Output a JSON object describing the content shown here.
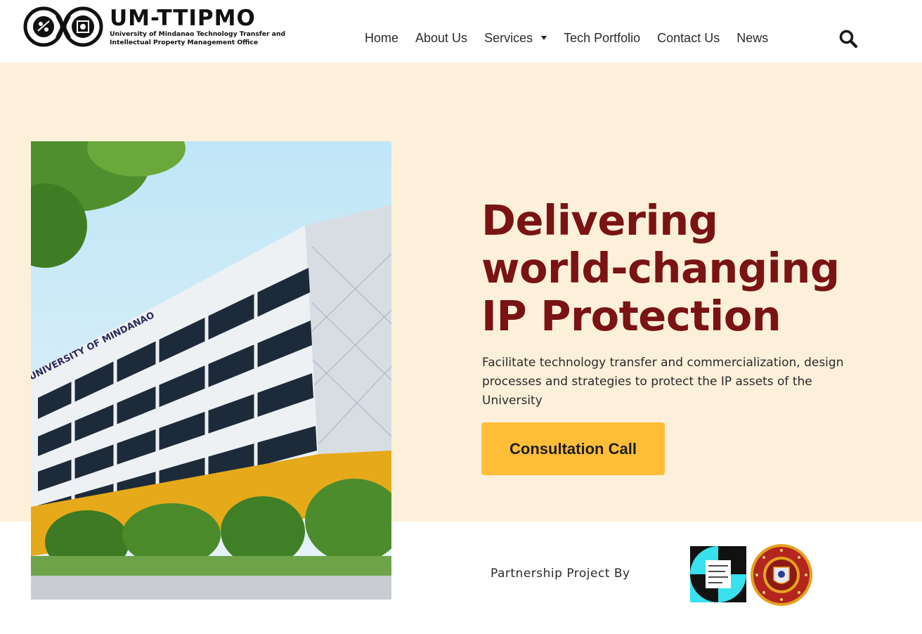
{
  "brand": {
    "title": "UM-TTIPMO",
    "subtitle": "University of Mindanao Technology Transfer and Intellectual Property Management Office"
  },
  "nav": {
    "items": [
      "Home",
      "About Us",
      "Services",
      "Tech Portfolio",
      "Contact Us",
      "News"
    ],
    "search_icon": "search-icon"
  },
  "hero": {
    "headline_lines": [
      "Delivering",
      "world-changing",
      "IP Protection"
    ],
    "description": "Facilitate technology transfer and commercialization, design processes and strategies to protect the IP assets of the University",
    "cta_label": "Consultation Call",
    "building_sign": "UNIVERSITY OF MINDANAO"
  },
  "partners": {
    "label": "Partnership Project By"
  },
  "colors": {
    "hero_bg": "#fdf0da",
    "headline": "#7a1313",
    "cta_bg": "#ffbd38",
    "ipo_cyan": "#39e0ee",
    "um_red": "#b3261e",
    "um_gold": "#e6a21f"
  }
}
